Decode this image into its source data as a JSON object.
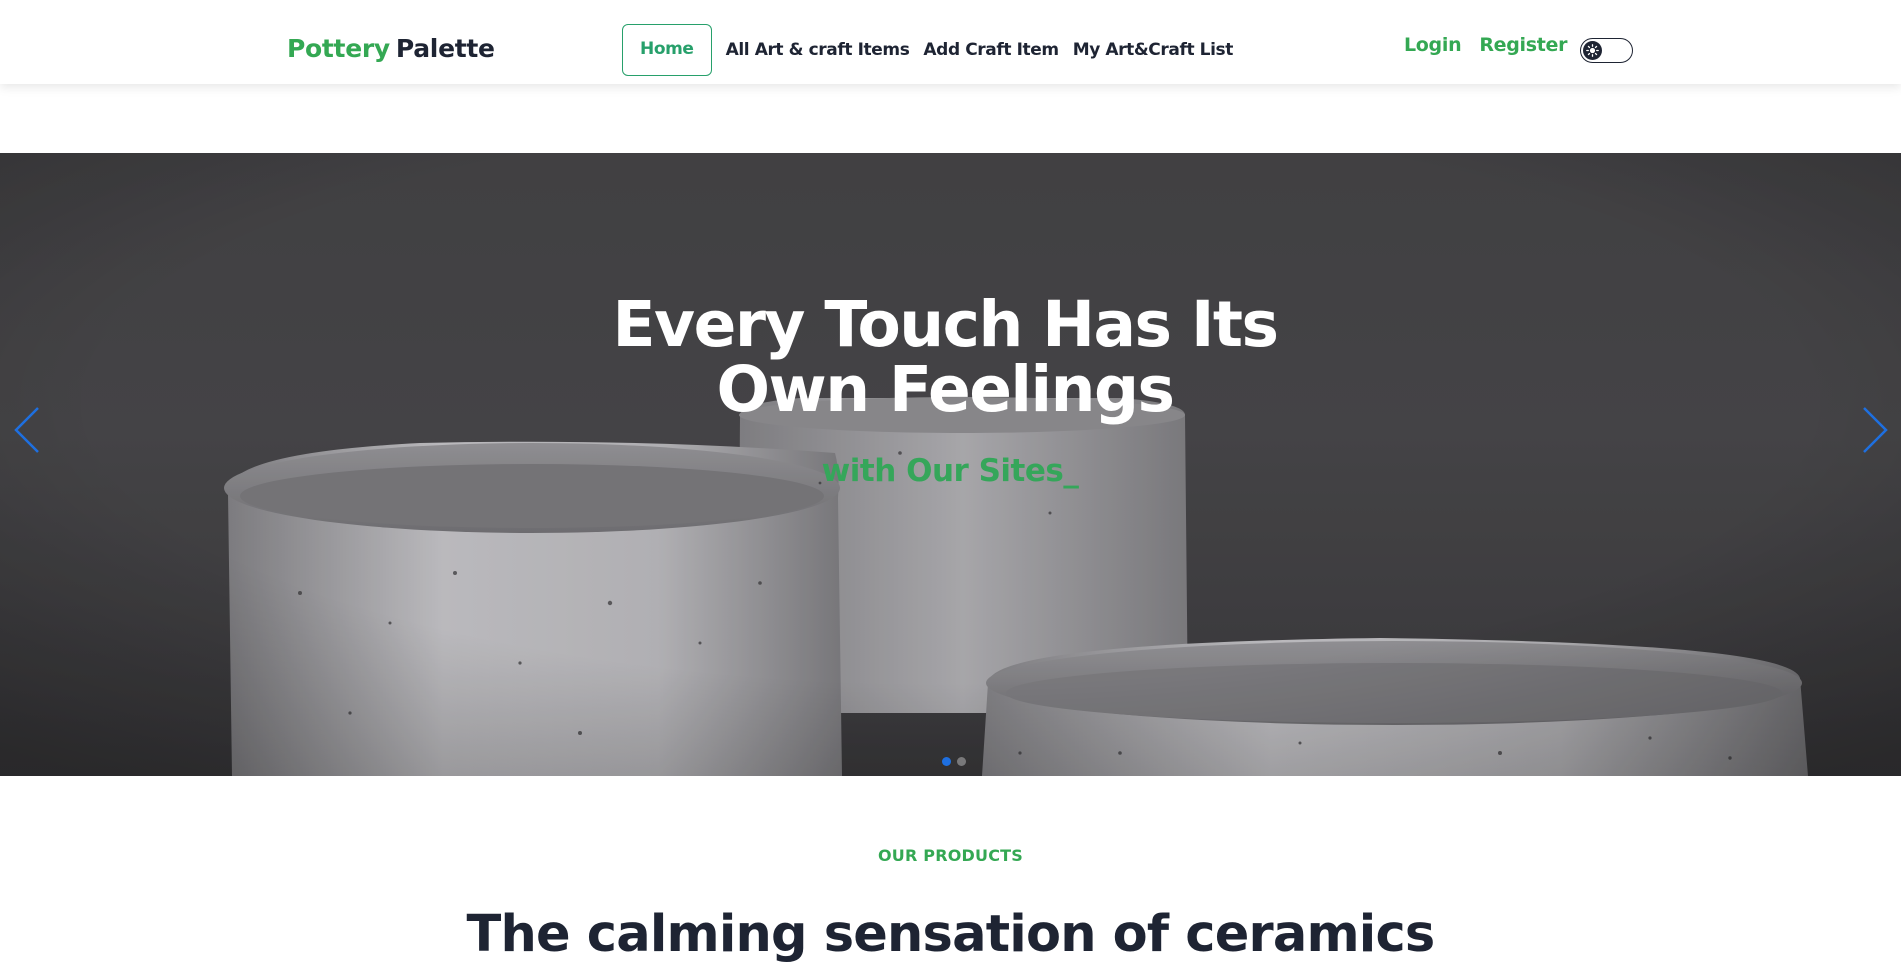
{
  "nav": {
    "logo_part1": "Pottery",
    "logo_part2": "Palette",
    "links": [
      "Home",
      "All Art & craft Items",
      "Add Craft Item",
      "My Art&Craft List"
    ],
    "login": "Login",
    "register": "Register",
    "theme_toggle_icon": "sun-icon"
  },
  "hero": {
    "title_line1": "Every Touch Has Its",
    "title_line2": "Own Feelings",
    "subtitle": "with Our Sites_",
    "prev_icon": "chevron-left-icon",
    "next_icon": "chevron-right-icon",
    "active_slide": 1
  },
  "products": {
    "eyebrow": "OUR PRODUCTS",
    "title": "The calming sensation of ceramics"
  },
  "colors": {
    "brand_green": "#34a853",
    "dark": "#1e2433",
    "carousel_accent": "#1e6fe0"
  }
}
